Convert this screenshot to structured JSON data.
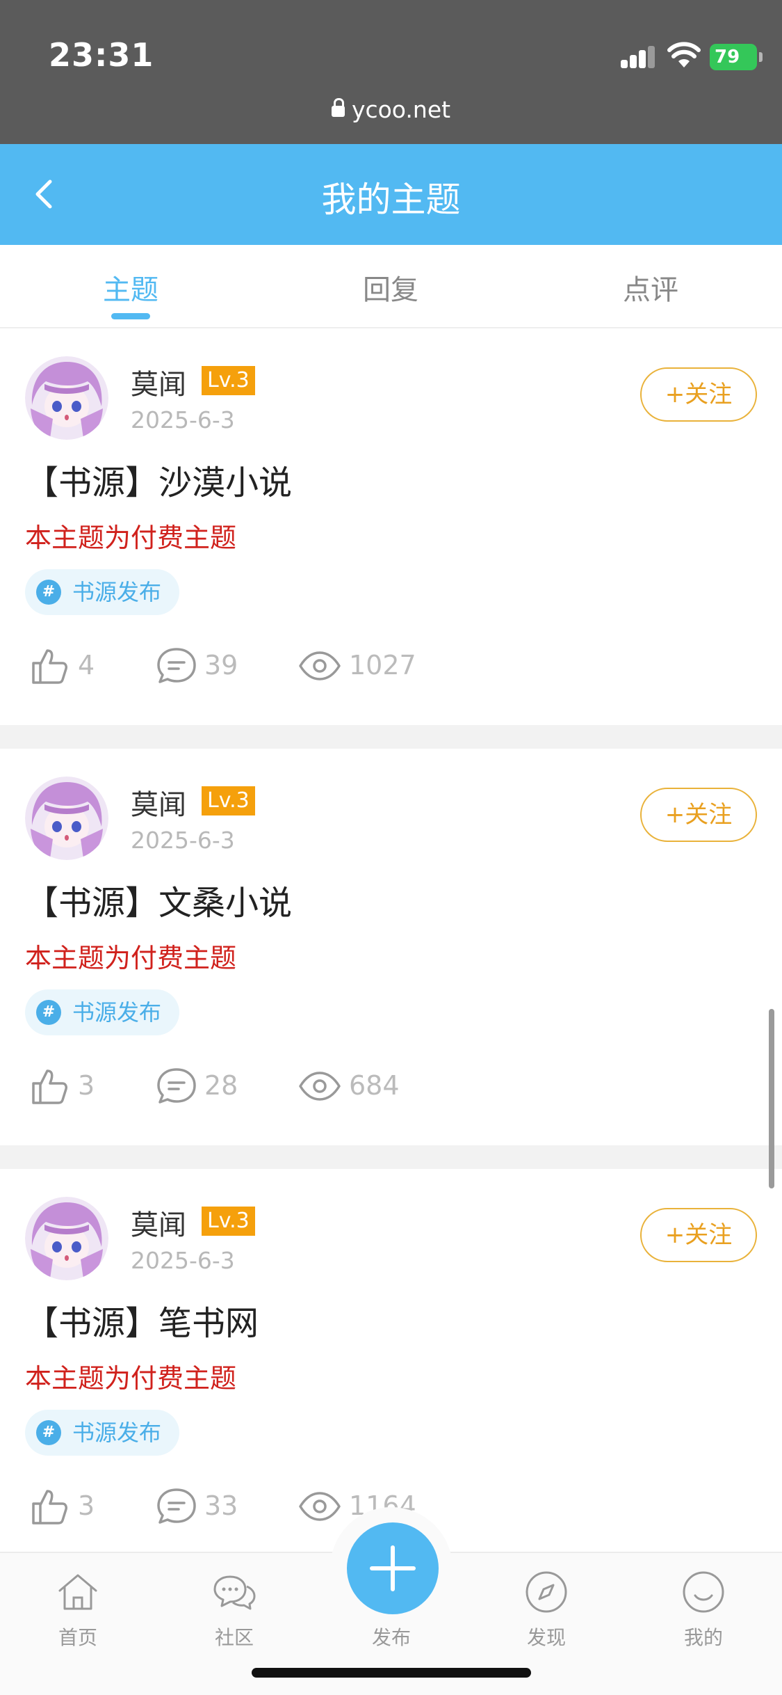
{
  "status_bar": {
    "time": "23:31",
    "battery": "79",
    "url": "ycoo.net"
  },
  "header": {
    "title": "我的主题"
  },
  "tabs": [
    {
      "label": "主题",
      "active": true
    },
    {
      "label": "回复",
      "active": false
    },
    {
      "label": "点评",
      "active": false
    }
  ],
  "posts": [
    {
      "author": "莫闻",
      "level": "Lv.3",
      "date": "2025-6-3",
      "follow_label": "+关注",
      "title": "【书源】沙漠小说",
      "paid_notice": "本主题为付费主题",
      "tag_icon": "#",
      "tag": "书源发布",
      "likes": "4",
      "comments": "39",
      "views": "1027"
    },
    {
      "author": "莫闻",
      "level": "Lv.3",
      "date": "2025-6-3",
      "follow_label": "+关注",
      "title": "【书源】文桑小说",
      "paid_notice": "本主题为付费主题",
      "tag_icon": "#",
      "tag": "书源发布",
      "likes": "3",
      "comments": "28",
      "views": "684"
    },
    {
      "author": "莫闻",
      "level": "Lv.3",
      "date": "2025-6-3",
      "follow_label": "+关注",
      "title": "【书源】笔书网",
      "paid_notice": "本主题为付费主题",
      "tag_icon": "#",
      "tag": "书源发布",
      "likes": "3",
      "comments": "33",
      "views": "1164"
    }
  ],
  "bottom_nav": [
    {
      "label": "首页",
      "icon": "home-icon"
    },
    {
      "label": "社区",
      "icon": "chat-icon"
    },
    {
      "label": "发布",
      "icon": "plus-icon"
    },
    {
      "label": "发现",
      "icon": "compass-icon"
    },
    {
      "label": "我的",
      "icon": "smile-icon"
    }
  ],
  "colors": {
    "accent": "#52b9f2",
    "level_badge": "#f5a00c",
    "follow": "#e9a020",
    "paid_text": "#d0211c"
  }
}
